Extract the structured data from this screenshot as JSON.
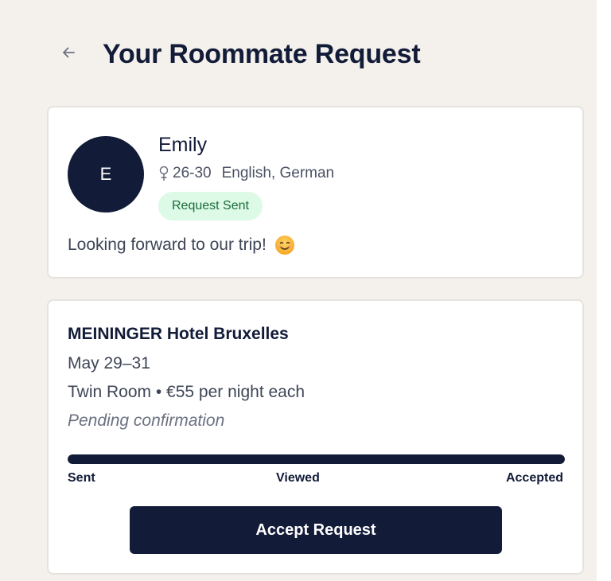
{
  "header": {
    "title": "Your Roommate Request",
    "back_icon": "arrow-left-icon"
  },
  "profile": {
    "avatar_initial": "E",
    "name": "Emily",
    "gender_icon": "female-icon",
    "age_range": "26-30",
    "languages": "English, German",
    "badge": "Request Sent",
    "message": "Looking forward to our trip!",
    "emoji_icon": "smiling-face-icon"
  },
  "booking": {
    "hotel_name": "MEININGER Hotel Bruxelles",
    "dates": "May 29–31",
    "room": "Twin Room • €55 per night each",
    "status": "Pending confirmation",
    "progress_percent": 100,
    "steps": [
      "Sent",
      "Viewed",
      "Accepted"
    ],
    "accept_label": "Accept Request"
  },
  "colors": {
    "primary": "#121b38",
    "badge_bg": "#dcfae6",
    "badge_text": "#1b6b3a",
    "background": "#f4f1ec"
  }
}
